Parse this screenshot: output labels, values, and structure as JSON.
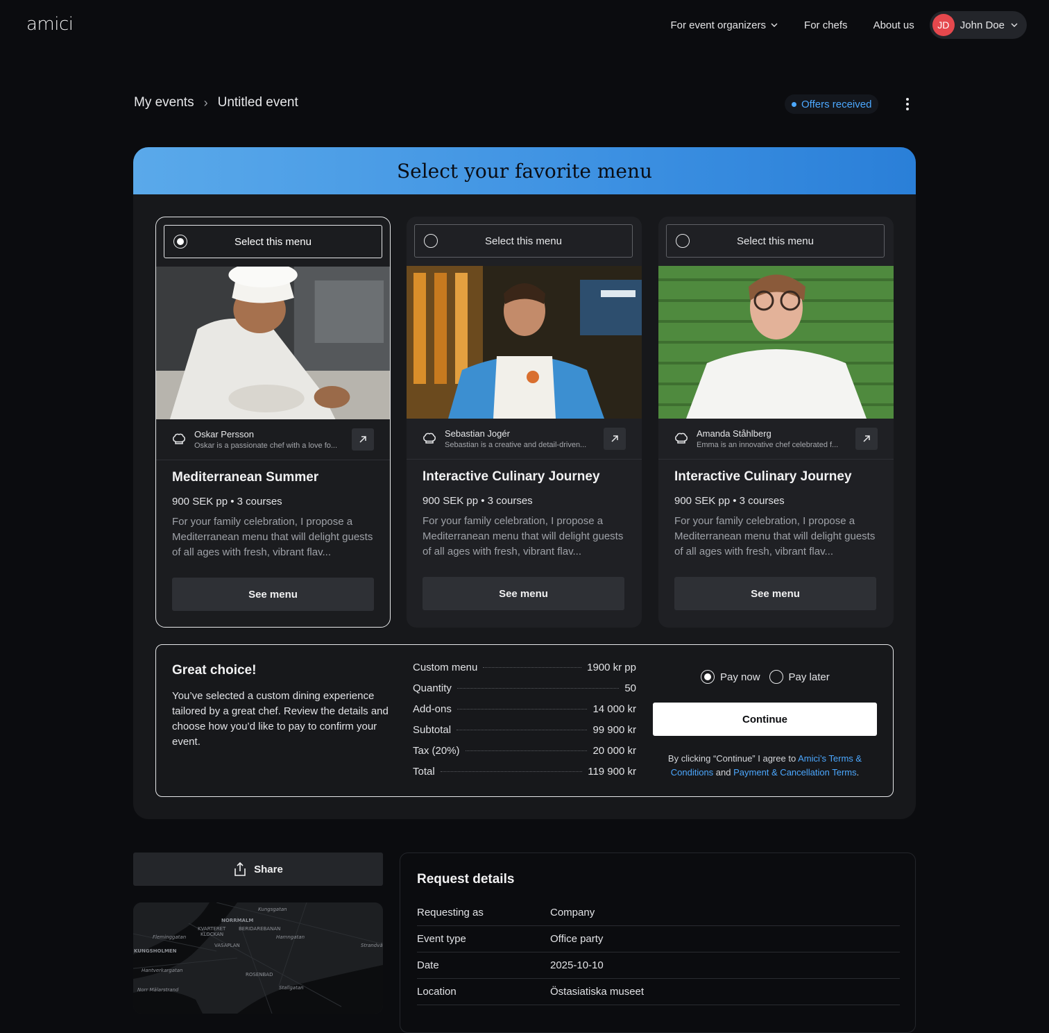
{
  "brand": "amici",
  "nav": {
    "organizers": "For event organizers",
    "chefs": "For chefs",
    "about": "About us",
    "user_initials": "JD",
    "user_name": "John Doe"
  },
  "breadcrumb": {
    "root": "My events",
    "sep": "›",
    "current": "Untitled event"
  },
  "status_label": "Offers received",
  "panel_title": "Select your favorite menu",
  "cards": [
    {
      "select_label": "Select this menu",
      "chef_name": "Oskar Persson",
      "chef_bio": "Oskar is a passionate chef with a love fo...",
      "title": "Mediterranean Summer",
      "meta": "900 SEK pp • 3 courses",
      "desc": "For your family celebration, I propose a Mediterranean menu that will delight guests of all ages with fresh, vibrant flav...",
      "button": "See menu",
      "selected": true
    },
    {
      "select_label": "Select this menu",
      "chef_name": "Sebastian Jogér",
      "chef_bio": "Sebastian is a creative and detail-driven...",
      "title": "Interactive Culinary Journey",
      "meta": "900 SEK pp • 3 courses",
      "desc": "For your family celebration, I propose a Mediterranean menu that will delight guests of all ages with fresh, vibrant flav...",
      "button": "See menu",
      "selected": false
    },
    {
      "select_label": "Select this menu",
      "chef_name": "Amanda Ståhlberg",
      "chef_bio": "Emma is an innovative chef celebrated f...",
      "title": "Interactive Culinary Journey",
      "meta": "900 SEK pp • 3 courses",
      "desc": "For your family celebration, I propose a Mediterranean menu that will delight guests of all ages with fresh, vibrant flav...",
      "button": "See menu",
      "selected": false
    }
  ],
  "summary": {
    "title": "Great choice!",
    "text": "You’ve selected a custom dining experience tailored by a great chef. Review the details and choose how you’d like to pay to confirm your event.",
    "rows": [
      {
        "label": "Custom menu",
        "value": "1900 kr pp"
      },
      {
        "label": "Quantity",
        "value": "50"
      },
      {
        "label": "Add-ons",
        "value": "14 000 kr"
      },
      {
        "label": "Subtotal",
        "value": "99 900 kr"
      },
      {
        "label": "Tax (20%)",
        "value": "20 000 kr"
      },
      {
        "label": "Total",
        "value": "119 900 kr"
      }
    ],
    "pay_now": "Pay now",
    "pay_later": "Pay later",
    "continue": "Continue",
    "terms_pre": "By clicking “Continue” I agree to ",
    "terms_link1": "Amici’s Terms & Conditions",
    "terms_mid": " and ",
    "terms_link2": "Payment & Cancellation Terms",
    "terms_post": "."
  },
  "share_label": "Share",
  "map_labels": [
    "NORRMALM",
    "KVARTERET",
    "BERIDAREBANAN",
    "KLOCKAN",
    "VASAPLAN",
    "KUNGSHOLMEN",
    "ROSENBAD",
    "Kungsgatan",
    "Fleminggatan",
    "Hamngatan",
    "Strandvägen",
    "Hantverkargatan",
    "Norr Mälarstrand",
    "Stallgatan"
  ],
  "request": {
    "title": "Request details",
    "rows": [
      {
        "k": "Requesting as",
        "v": "Company"
      },
      {
        "k": "Event type",
        "v": "Office party"
      },
      {
        "k": "Date",
        "v": "2025-10-10"
      },
      {
        "k": "Location",
        "v": "Östasiatiska museet"
      }
    ]
  }
}
